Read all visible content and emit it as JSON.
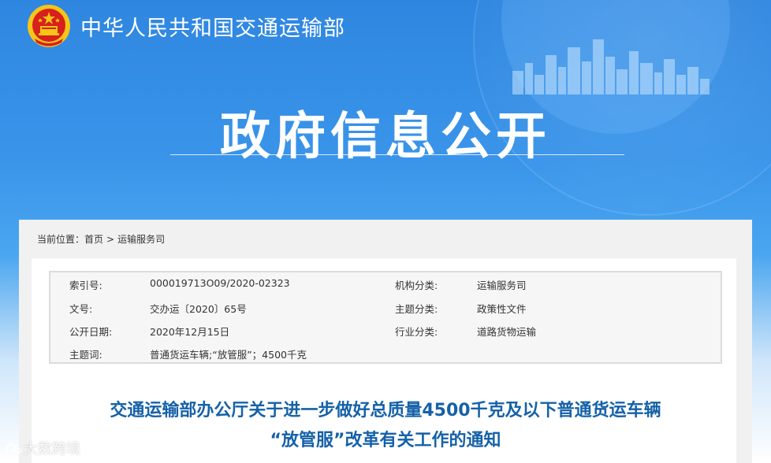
{
  "header": {
    "site_name": "中华人民共和国交通运输部",
    "banner_title": "政府信息公开",
    "emblem_icon": "national-emblem-icon"
  },
  "breadcrumb": {
    "prefix": "当前位置：",
    "items": [
      "首页",
      "运输服务司"
    ],
    "separator": ">"
  },
  "meta": {
    "index_label": "索引号:",
    "index_value": "000019713O09/2020-02323",
    "org_label": "机构分类:",
    "org_value": "运输服务司",
    "doc_no_label": "文号:",
    "doc_no_value": "交办运〔2020〕65号",
    "topic_label": "主题分类:",
    "topic_value": "政策性文件",
    "date_label": "公开日期:",
    "date_value": "2020年12月15日",
    "industry_label": "行业分类:",
    "industry_value": "道路货物运输",
    "keywords_label": "主题词:",
    "keywords_value": "普通货运车辆;“放管服”；4500千克"
  },
  "document": {
    "title_line1": "交通运输部办公厅关于进一步做好总质量4500千克及以下普通货运车辆",
    "title_line2": "“放管服”改革有关工作的通知"
  },
  "watermark": {
    "text": "大数跨境"
  },
  "colors": {
    "banner_blue": "#3a95ea",
    "title_blue": "#1561a8",
    "emblem_red": "#d8201c",
    "emblem_gold": "#f5c518"
  }
}
